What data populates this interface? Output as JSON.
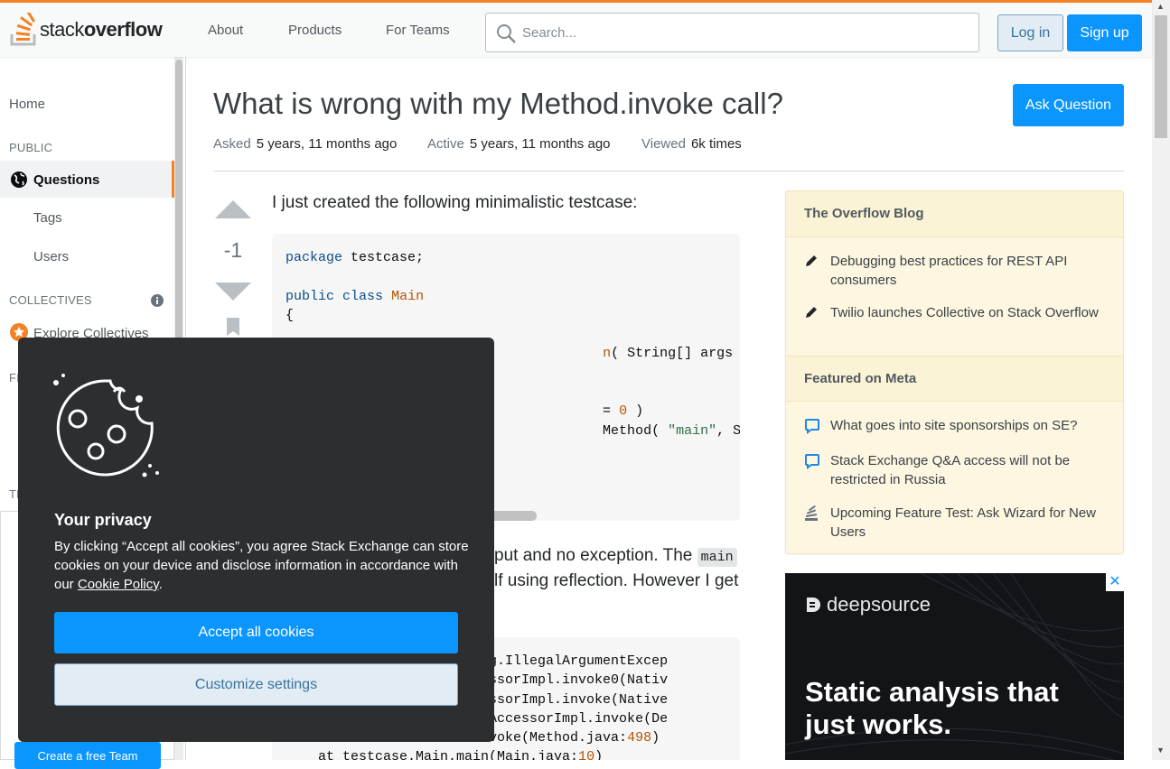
{
  "header": {
    "logo_text_light": "stack",
    "logo_text_bold": "overflow",
    "nav": [
      "About",
      "Products",
      "For Teams"
    ],
    "search_placeholder": "Search...",
    "login_label": "Log in",
    "signup_label": "Sign up",
    "accent_color": "#f48225",
    "primary_color": "#0a95ff"
  },
  "sidebar": {
    "home": "Home",
    "public_heading": "PUBLIC",
    "questions": "Questions",
    "tags": "Tags",
    "users": "Users",
    "collectives_heading": "COLLECTIVES",
    "explore_collectives": "Explore Collectives",
    "partial_heading_1": "FI",
    "partial_heading_2": "TE",
    "create_team": "Create a free Team"
  },
  "question": {
    "title": "What is wrong with my Method.invoke call?",
    "ask_label": "Ask Question",
    "asked_label": "Asked",
    "asked_value": "5 years, 11 months ago",
    "active_label": "Active",
    "active_value": "5 years, 11 months ago",
    "viewed_label": "Viewed",
    "viewed_value": "6k times",
    "votes": "-1",
    "intro": "I just created the following minimalistic testcase:",
    "para_part1": "put and no exception. The",
    "para_code": "main",
    "para_part2": "lf using reflection. However I get"
  },
  "blog": {
    "heading": "The Overflow Blog",
    "items": [
      "Debugging best practices for REST API consumers",
      "Twilio launches Collective on Stack Overflow"
    ],
    "meta_heading": "Featured on Meta",
    "meta_items": [
      "What goes into site sponsorships on SE?",
      "Stack Exchange Q&A access will not be restricted in Russia",
      "Upcoming Feature Test: Ask Wizard for New Users"
    ]
  },
  "ad": {
    "brand": "deepsource",
    "headline": "Static analysis that just works.",
    "close": "✕"
  },
  "cookie": {
    "title": "Your privacy",
    "text": "By clicking “Accept all cookies”, you agree Stack Exchange can store cookies on your device and disclose information in accordance with our",
    "link": "Cookie Policy",
    "accept": "Accept all cookies",
    "customize": "Customize settings"
  }
}
